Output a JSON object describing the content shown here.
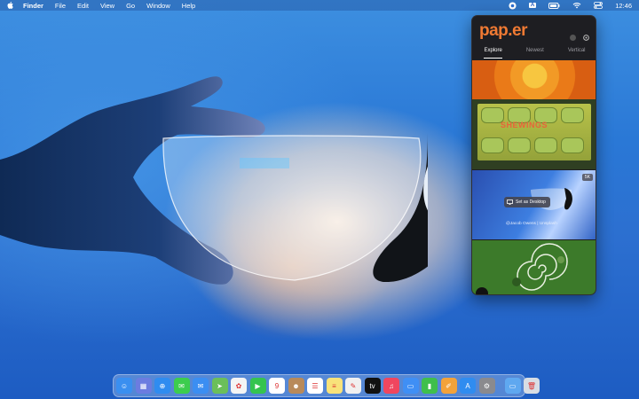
{
  "menubar": {
    "items": [
      "Finder",
      "File",
      "Edit",
      "View",
      "Go",
      "Window",
      "Help"
    ],
    "clock": "12:46",
    "input_badge": "A"
  },
  "panel": {
    "logo": "pap.er",
    "tabs": [
      "Explore",
      "Newest",
      "Vertical"
    ],
    "active_tab": "Explore",
    "thumb2_text": "SHEWINGS",
    "thumb3": {
      "badge": "5K",
      "set_desktop": "Set as Desktop",
      "credit": "@Jacob Owens | Unsplash"
    }
  },
  "dock": {
    "apps": [
      {
        "name": "finder-app",
        "color": "#3a8ff0",
        "glyph": "☺"
      },
      {
        "name": "launchpad-app",
        "color": "#6b7ce0",
        "glyph": "▦"
      },
      {
        "name": "safari-app",
        "color": "#2f8cf0",
        "glyph": "⊕"
      },
      {
        "name": "messages-app",
        "color": "#3ccd4e",
        "glyph": "✉"
      },
      {
        "name": "mail-app",
        "color": "#3b8ef2",
        "glyph": "✉"
      },
      {
        "name": "maps-app",
        "color": "#6bbf5a",
        "glyph": "➤"
      },
      {
        "name": "photos-app",
        "color": "#f4f4f4",
        "glyph": "✿"
      },
      {
        "name": "facetime-app",
        "color": "#35c44f",
        "glyph": "▶"
      },
      {
        "name": "calendar-app",
        "color": "#ffffff",
        "glyph": "9"
      },
      {
        "name": "contacts-app",
        "color": "#b88a5a",
        "glyph": "☻"
      },
      {
        "name": "reminders-app",
        "color": "#ffffff",
        "glyph": "☰"
      },
      {
        "name": "notes-app",
        "color": "#f8e27a",
        "glyph": "≡"
      },
      {
        "name": "freeform-app",
        "color": "#f0f0f0",
        "glyph": "✎"
      },
      {
        "name": "tv-app",
        "color": "#111111",
        "glyph": "tv"
      },
      {
        "name": "music-app",
        "color": "#f0465f",
        "glyph": "♫"
      },
      {
        "name": "keynote-app",
        "color": "#3f8ff5",
        "glyph": "▭"
      },
      {
        "name": "numbers-app",
        "color": "#3fbf4c",
        "glyph": "▮"
      },
      {
        "name": "pages-app",
        "color": "#f3a23a",
        "glyph": "✐"
      },
      {
        "name": "app-store-app",
        "color": "#2f8cf0",
        "glyph": "A"
      },
      {
        "name": "system-settings-app",
        "color": "#8a8a8e",
        "glyph": "⚙"
      },
      {
        "name": "downloads-folder",
        "color": "#5fa8f0",
        "glyph": "▭"
      },
      {
        "name": "trash-app",
        "color": "#d8dde4",
        "glyph": "🗑"
      }
    ]
  }
}
